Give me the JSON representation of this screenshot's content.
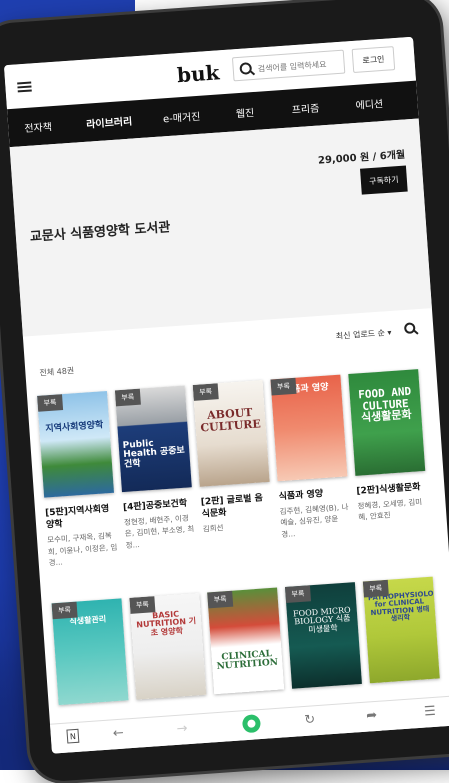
{
  "header": {
    "logo": "buk",
    "search_placeholder": "검색어를 입력하세요",
    "login_label": "로그인"
  },
  "nav": [
    "전자책",
    "라이브러리",
    "e-매거진",
    "웹진",
    "프리즘",
    "에디션"
  ],
  "banner": {
    "title": "교문사 식품영양학 도서관",
    "price": "29,000 원 / 6개월",
    "subscribe_label": "구독하기"
  },
  "list": {
    "count": "전체 48권",
    "sort_label": "최신 업로드 순 ▾"
  },
  "badge_label": "부록",
  "books_row1": [
    {
      "cover": "지역사회영양학",
      "title": "[5판]지역사회영양학",
      "authors": "모수미, 구재옥, 김복희, 이윤나, 이정은, 임경..."
    },
    {
      "cover": "Public Health 공중보건학",
      "title": "[4판]공중보건학",
      "authors": "정현정, 배현주, 이경은, 김미현, 부소영, 최정..."
    },
    {
      "cover": "ABOUT CULTURE",
      "title": "[2판] 글로벌 음식문화",
      "authors": "김희선"
    },
    {
      "cover": "식품과 영양",
      "title": "식품과 영양",
      "authors": "김주현, 김혜영(B), 나예슬, 심유진, 양윤경..."
    },
    {
      "cover": "FOOD AND CULTURE 식생활문화",
      "title": "[2판]식생활문화",
      "authors": "정혜경, 오세영, 김미혜, 안효진"
    }
  ],
  "books_row2": [
    {
      "cover": "식생활관리"
    },
    {
      "cover": "BASIC NUTRITION 기초 영양학"
    },
    {
      "cover": "CLINICAL NUTRITION"
    },
    {
      "cover": "FOOD MICRO BIOLOGY 식품미생물학"
    },
    {
      "cover": "PATHOPHYSIOLOGY for CLINICAL NUTRITION 병태생리학"
    }
  ],
  "bottom_bar": {
    "n_label": "N",
    "icons": [
      "back-arrow-icon",
      "forward-arrow-icon",
      "home-icon",
      "refresh-icon",
      "share-icon",
      "menu-icon"
    ]
  },
  "colors": {
    "background_blue": "#2447c2",
    "nav_bg": "#111111",
    "badge": "#555555",
    "home_green": "#2bbf6a"
  }
}
